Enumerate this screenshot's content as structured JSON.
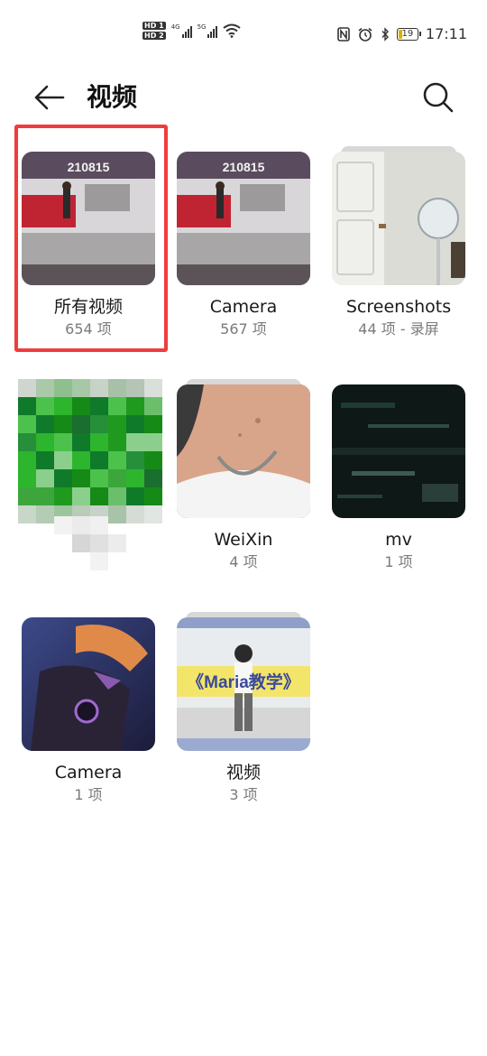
{
  "status_bar": {
    "sim1": "HD 1",
    "sim2": "HD 2",
    "net1": "4G",
    "net2": "5G",
    "battery": "19",
    "battery_level": 0.19,
    "time": "17:11"
  },
  "header": {
    "title": "视频",
    "back_icon": "arrow-left-icon",
    "search_icon": "search-icon"
  },
  "albums": [
    {
      "name": "所有视频",
      "count": "654 项",
      "thumb": "room-video"
    },
    {
      "name": "Camera",
      "count": "567 项",
      "thumb": "room-video"
    },
    {
      "name": "Screenshots",
      "count": "44 项 - 录屏",
      "thumb": "door-fan"
    },
    {
      "name": "",
      "count": "",
      "thumb": "mosaic-green"
    },
    {
      "name": "WeiXin",
      "count": "4 项",
      "thumb": "neck-closeup"
    },
    {
      "name": "mv",
      "count": "1 项",
      "thumb": "dark-glitch"
    },
    {
      "name": "Camera",
      "count": "1 项",
      "thumb": "game-character"
    },
    {
      "name": "视频",
      "count": "3 项",
      "thumb": "dance-tutorial"
    }
  ],
  "thumb_text": {
    "video_date": "210815",
    "maria_banner": "《Maria教学》"
  },
  "colors": {
    "highlight": "#f03c3c",
    "text_primary": "#1a1a1a",
    "text_secondary": "#7a7a7a"
  }
}
